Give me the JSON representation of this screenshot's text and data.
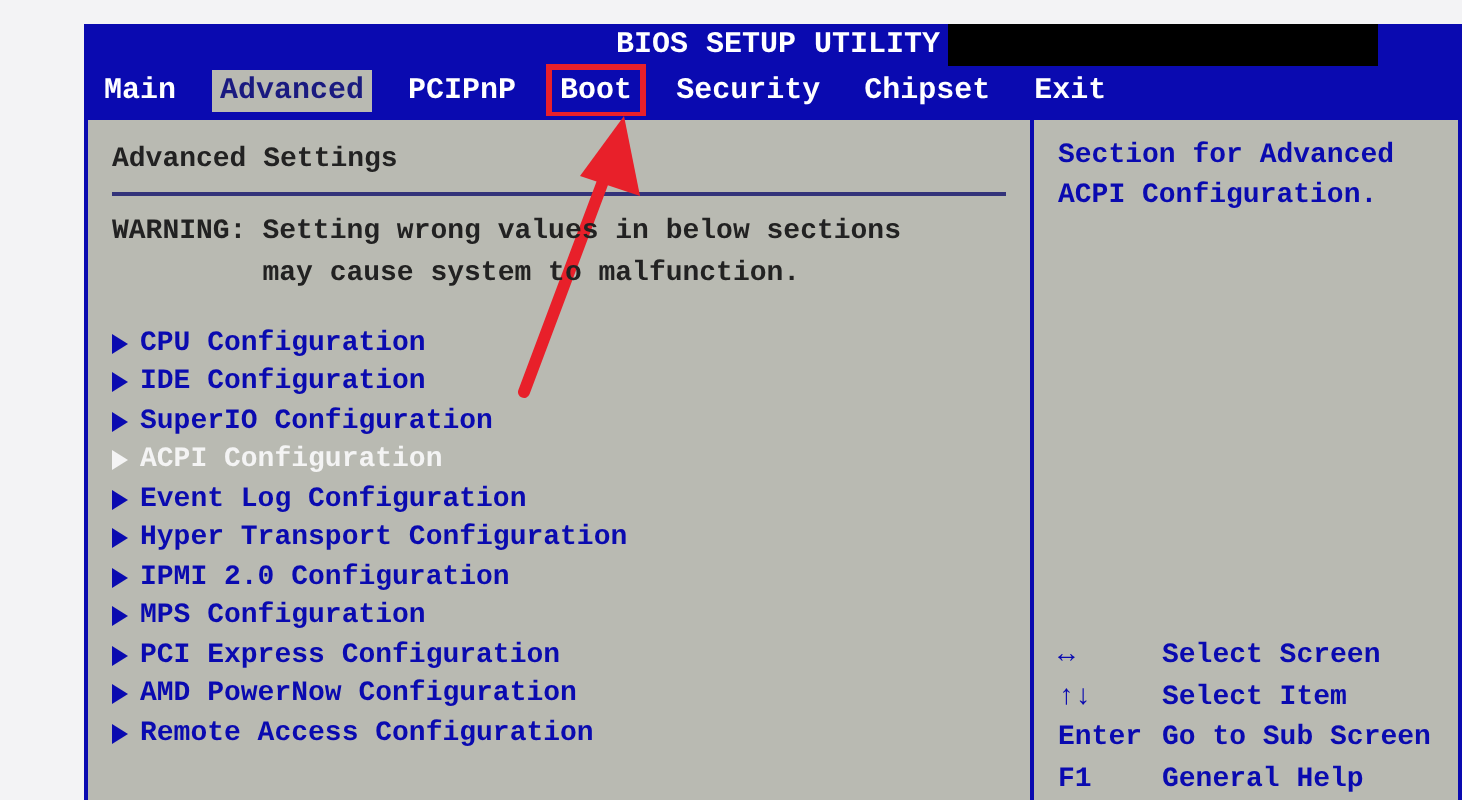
{
  "window": {
    "title": "BIOS SETUP UTILITY"
  },
  "tabs": [
    {
      "label": "Main",
      "selected": false,
      "highlighted": false
    },
    {
      "label": "Advanced",
      "selected": true,
      "highlighted": false
    },
    {
      "label": "PCIPnP",
      "selected": false,
      "highlighted": false
    },
    {
      "label": "Boot",
      "selected": false,
      "highlighted": true
    },
    {
      "label": "Security",
      "selected": false,
      "highlighted": false
    },
    {
      "label": "Chipset",
      "selected": false,
      "highlighted": false
    },
    {
      "label": "Exit",
      "selected": false,
      "highlighted": false
    }
  ],
  "main_panel": {
    "heading": "Advanced Settings",
    "warning_label": "WARNING:",
    "warning_lines": [
      "Setting wrong values in below sections",
      "may cause system to malfunction."
    ],
    "items": [
      {
        "label": "CPU Configuration",
        "selected": false
      },
      {
        "label": "IDE Configuration",
        "selected": false
      },
      {
        "label": "SuperIO Configuration",
        "selected": false
      },
      {
        "label": "ACPI Configuration",
        "selected": true
      },
      {
        "label": "Event Log Configuration",
        "selected": false
      },
      {
        "label": "Hyper Transport Configuration",
        "selected": false
      },
      {
        "label": "IPMI 2.0 Configuration",
        "selected": false
      },
      {
        "label": "MPS Configuration",
        "selected": false
      },
      {
        "label": "PCI Express Configuration",
        "selected": false
      },
      {
        "label": "AMD PowerNow Configuration",
        "selected": false
      },
      {
        "label": "Remote Access Configuration",
        "selected": false
      }
    ]
  },
  "help_panel": {
    "description": "Section for Advanced ACPI Configuration.",
    "keys": [
      {
        "key": "↔",
        "action": "Select Screen"
      },
      {
        "key": "↑↓",
        "action": "Select Item"
      },
      {
        "key": "Enter",
        "action": "Go to Sub Screen"
      },
      {
        "key": "F1",
        "action": "General Help"
      }
    ]
  }
}
